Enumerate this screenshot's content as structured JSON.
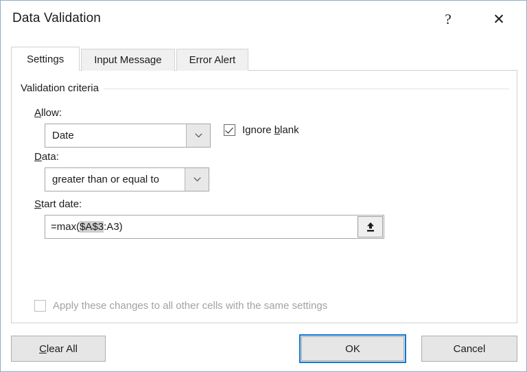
{
  "window": {
    "title": "Data Validation",
    "help_glyph": "?",
    "close_glyph": "✕",
    "accent_color": "#1278d4",
    "border_color": "#8aadc8"
  },
  "tabs": [
    {
      "label": "Settings",
      "active": true
    },
    {
      "label": "Input Message",
      "active": false
    },
    {
      "label": "Error Alert",
      "active": false
    }
  ],
  "settings_tab": {
    "group_label": "Validation criteria",
    "allow": {
      "label_prefix": "",
      "label_accel": "A",
      "label_suffix": "llow:",
      "value": "Date"
    },
    "ignore_blank": {
      "label_prefix": "Ignore ",
      "label_accel": "b",
      "label_suffix": "lank",
      "checked": true
    },
    "data": {
      "label_prefix": "",
      "label_accel": "D",
      "label_suffix": "ata:",
      "value": "greater than or equal to"
    },
    "start_date": {
      "label_prefix": "",
      "label_accel": "S",
      "label_suffix": "tart date:",
      "value_before": "=max(",
      "value_selected": "$A$3",
      "value_after": ":A3)",
      "full_value": "=max($A$3:A3)",
      "selection_color": "#cfcfcf",
      "collapse_button_icon": "collapse-dialog-icon"
    },
    "apply_changes": {
      "label": "Apply these changes to all other cells with the same settings",
      "checked": false,
      "disabled": true
    }
  },
  "buttons": {
    "clear_all": {
      "label_prefix": "",
      "label_accel": "C",
      "label_suffix": "lear All"
    },
    "ok": {
      "label": "OK",
      "focused": true
    },
    "cancel": {
      "label": "Cancel"
    }
  }
}
